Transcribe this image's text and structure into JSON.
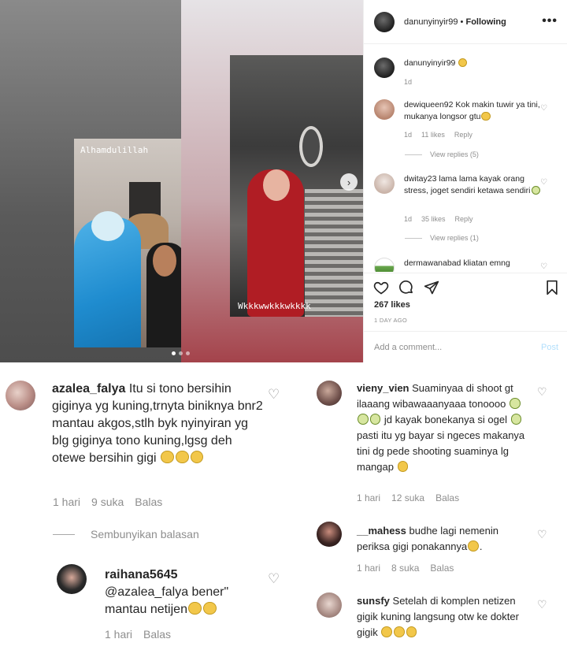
{
  "post": {
    "header": {
      "username": "danunyinyir99",
      "separator": " • ",
      "follow_status": "Following",
      "more": "•••"
    },
    "media": {
      "clip1_caption": "Alhamdulillah",
      "clip2_caption": "Wkkkwwkkkwkkkk",
      "next_arrow": "›",
      "dots_count": 3
    },
    "caption": {
      "username": "danunyinyir99",
      "emoji": "smiling-face-emoji",
      "age": "1d"
    },
    "comments": [
      {
        "username": "dewiqueen92",
        "text": "Kok makin tuwir ya tini, mukanya longsor gtu",
        "age": "1d",
        "likes": "11 likes",
        "reply": "Reply",
        "view_replies": "View replies (5)"
      },
      {
        "username": "dwitay23",
        "text": "lama lama kayak orang stress, joget sendiri ketawa sendiri",
        "age": "1d",
        "likes": "35 likes",
        "reply": "Reply",
        "view_replies": "View replies (1)"
      },
      {
        "username": "dermawanabad",
        "text": "kliatan emng"
      }
    ],
    "likes": "267 likes",
    "date": "1 DAY AGO",
    "add_comment_placeholder": "Add a comment...",
    "post_button": "Post"
  },
  "left_panel": {
    "comments": [
      {
        "username": "azalea_falya",
        "text": "Itu si tono bersihin giginya yg kuning,trnyta biniknya bnr2 mantau akgos,stlh byk nyinyiran yg blg giginya tono kuning,lgsg deh otewe bersihin gigi",
        "time": "1 hari",
        "likes": "9 suka",
        "reply": "Balas"
      },
      {
        "username": "raihana5645",
        "text": "@azalea_falya bener\" mantau netijen",
        "time": "1 hari",
        "reply": "Balas"
      }
    ],
    "hide_replies": "Sembunyikan balasan"
  },
  "right_panel": {
    "comments": [
      {
        "username": "vieny_vien",
        "text_parts": [
          "Suaminyaa di shoot gt ilaaang wibawaaanyaaa tonoooo",
          "jd kayak bonekanya si ogel",
          "pasti itu yg bayar si ngeces makanya tini dg pede shooting suaminya lg mangap"
        ],
        "time": "1 hari",
        "likes": "12 suka",
        "reply": "Balas"
      },
      {
        "username": "__mahess",
        "text": "budhe lagi nemenin periksa gigi ponakannya",
        "time": "1 hari",
        "likes": "8 suka",
        "reply": "Balas"
      },
      {
        "username": "sunsfy",
        "text": "Setelah di komplen netizen gigik kuning langsung otw ke dokter gigik",
        "time": ""
      }
    ]
  },
  "colors": {
    "link_blue": "#b2dffc",
    "muted_gray": "#8e8e8e",
    "text": "#262626"
  }
}
